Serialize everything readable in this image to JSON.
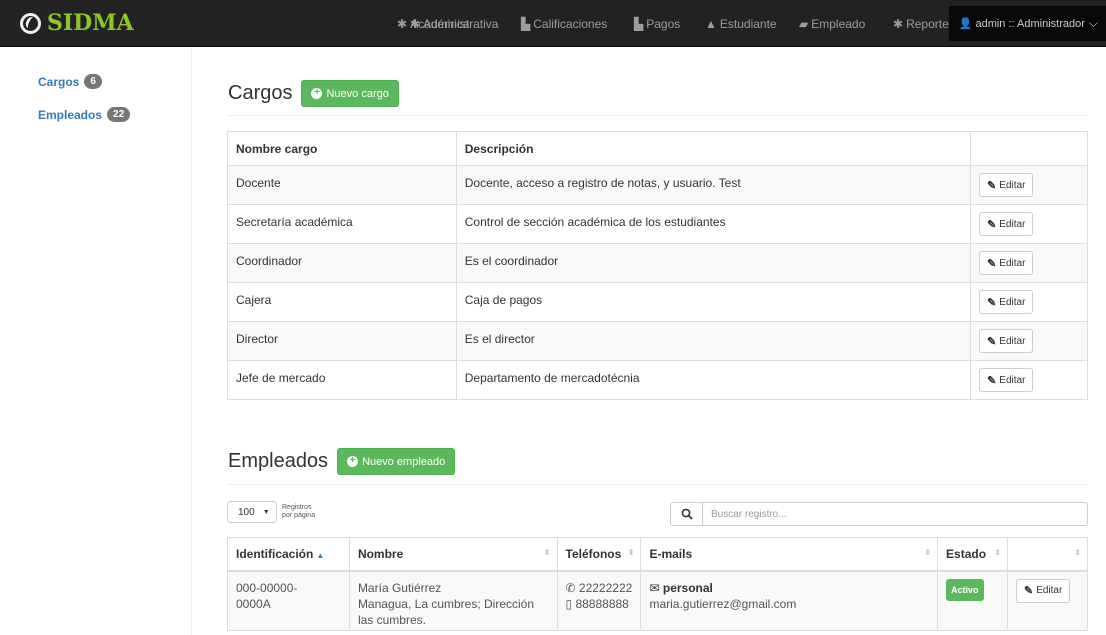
{
  "brand": {
    "name": "SIDMA"
  },
  "nav": {
    "items": [
      {
        "label": "Académica",
        "icon": "gear-icon"
      },
      {
        "label": "Administrativa",
        "icon": "gear-icon"
      },
      {
        "label": "Calificaciones",
        "icon": "file-icon"
      },
      {
        "label": "Pagos",
        "icon": "file-icon"
      },
      {
        "label": "Estudiante",
        "icon": "graduation-cap-icon"
      },
      {
        "label": "Empleado",
        "icon": "folder-open-icon"
      },
      {
        "label": "Reportes",
        "icon": "gear-icon"
      }
    ],
    "user": "admin :: Administrador"
  },
  "sidebar": {
    "items": [
      {
        "label": "Cargos",
        "count": "6"
      },
      {
        "label": "Empleados",
        "count": "22"
      }
    ]
  },
  "cargos": {
    "title": "Cargos",
    "new_button": "Nuevo cargo",
    "columns": [
      "Nombre cargo",
      "Descripción",
      ""
    ],
    "rows": [
      {
        "name": "Docente",
        "description": "Docente, acceso a registro de notas, y usuario. Test"
      },
      {
        "name": "Secretaría académica",
        "description": "Control de sección académica de los estudiantes"
      },
      {
        "name": "Coordinador",
        "description": "Es el coordinador"
      },
      {
        "name": "Cajera",
        "description": "Caja de pagos"
      },
      {
        "name": "Director",
        "description": "Es el director"
      },
      {
        "name": "Jefe de mercado",
        "description": "Departamento de mercadotécnia"
      }
    ],
    "edit_label": "Editar"
  },
  "empleados": {
    "title": "Empleados",
    "new_button": "Nuevo empleado",
    "page_length": "100",
    "page_length_label_1": "Registros",
    "page_length_label_2": "por página",
    "search_placeholder": "Buscar registro...",
    "columns": [
      "Identificación",
      "Nombre",
      "Teléfonos",
      "E-mails",
      "Estado",
      ""
    ],
    "rows": [
      {
        "id_line1": "000-00000-",
        "id_line2": "0000A",
        "name": "María Gutiérrez",
        "address_line1": "Managua, La cumbres; Dirección",
        "address_line2": "las cumbres.",
        "phone": "22222222",
        "mobile": "88888888",
        "email_type": "personal",
        "email": "maria.gutierrez@gmail.com",
        "status": "Activo"
      }
    ],
    "edit_label": "Editar"
  },
  "colors": {
    "navbar": "#222222",
    "brand": "#8ec524",
    "link": "#337ab7",
    "success": "#5cb85c",
    "badge": "#777777"
  }
}
